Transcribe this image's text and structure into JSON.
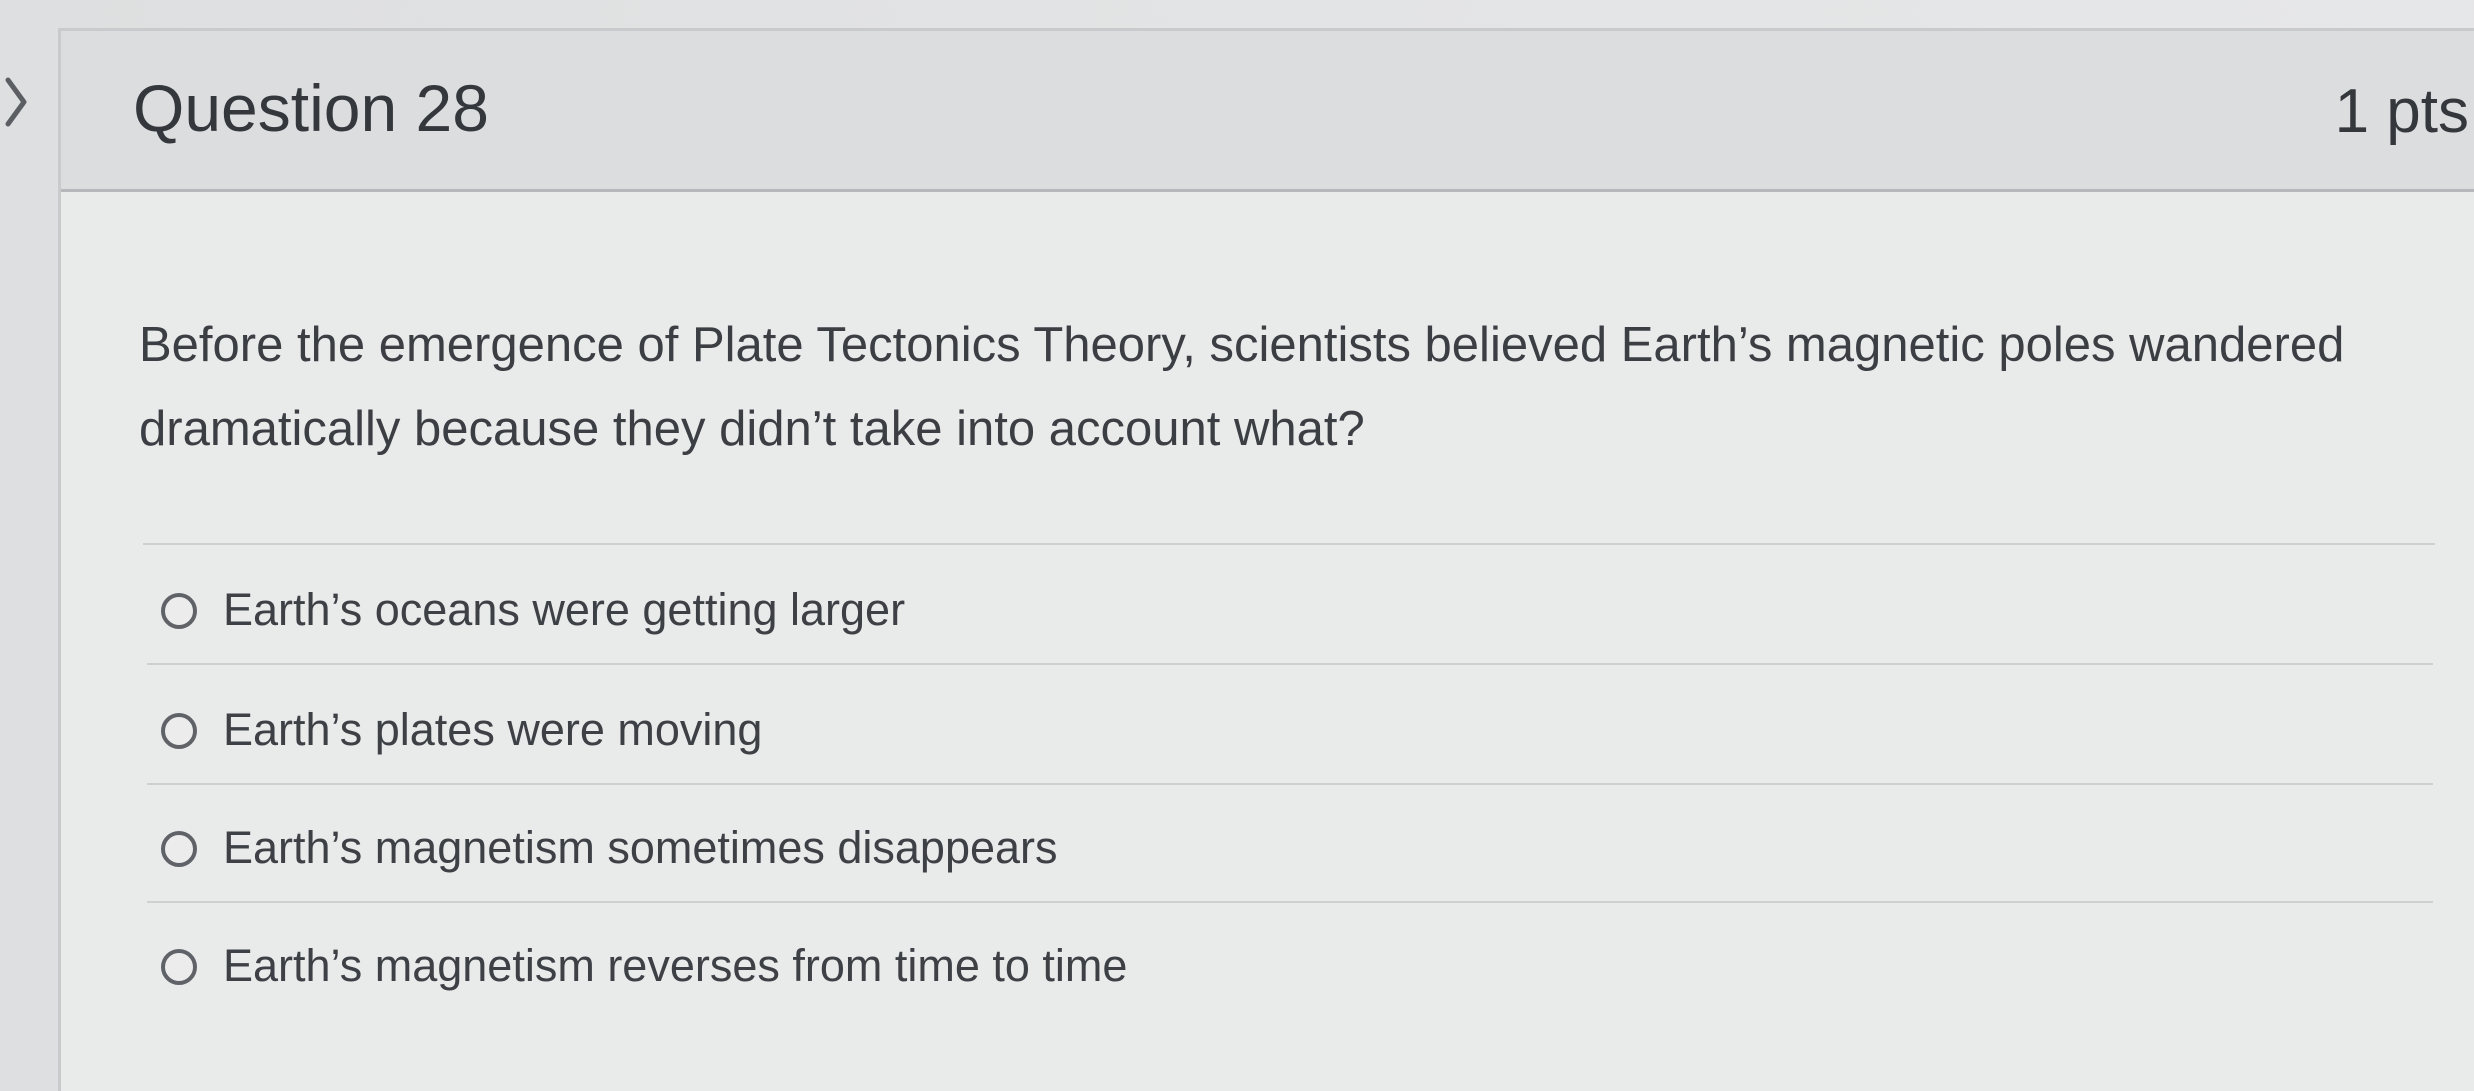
{
  "question": {
    "title": "Question 28",
    "points": "1 pts",
    "prompt": "Before the emergence of Plate Tectonics Theory, scientists believed Earth’s magnetic poles wandered dramatically because they didn’t take into account what?"
  },
  "answers": [
    {
      "label": "Earth’s oceans were getting larger",
      "selected": false
    },
    {
      "label": "Earth’s plates were moving",
      "selected": false
    },
    {
      "label": "Earth’s magnetism sometimes disappears",
      "selected": false
    },
    {
      "label": "Earth’s magnetism reverses from time to time",
      "selected": false
    }
  ],
  "icons": {
    "nav": "chevron-right-icon",
    "radio": "radio-unchecked-icon"
  },
  "colors": {
    "header_background": "#dcdddf",
    "card_background": "#e9eaea",
    "text": "#3b3f44",
    "radio_border": "#5f6368"
  }
}
